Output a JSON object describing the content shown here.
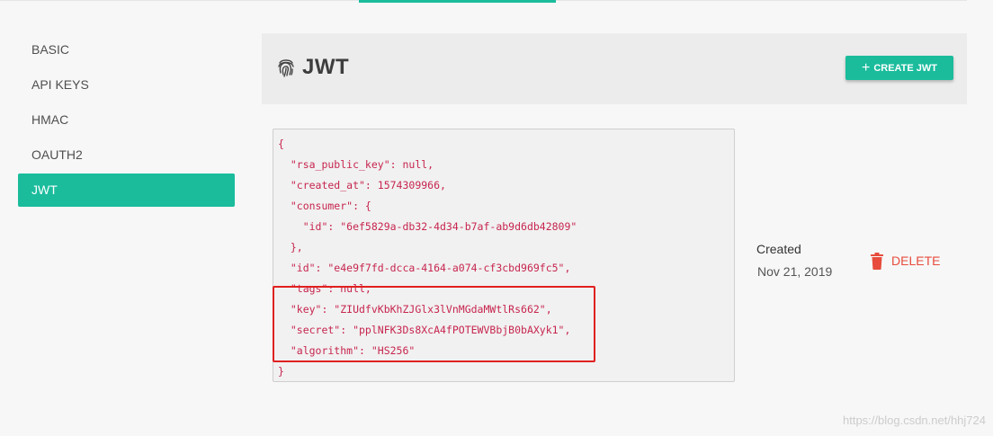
{
  "sidebar": {
    "items": [
      {
        "label": "BASIC",
        "active": false
      },
      {
        "label": "API KEYS",
        "active": false
      },
      {
        "label": "HMAC",
        "active": false
      },
      {
        "label": "OAUTH2",
        "active": false
      },
      {
        "label": "JWT",
        "active": true
      }
    ]
  },
  "header": {
    "icon": "fingerprint-icon",
    "title": "JWT",
    "create_button_label": "CREATE JWT"
  },
  "credential": {
    "json_lines": [
      "{",
      "  \"rsa_public_key\": null,",
      "  \"created_at\": 1574309966,",
      "  \"consumer\": {",
      "    \"id\": \"6ef5829a-db32-4d34-b7af-ab9d6db42809\"",
      "  },",
      "  \"id\": \"e4e9f7fd-dcca-4164-a074-cf3cbd969fc5\",",
      "  \"tags\": null,",
      "  \"key\": \"ZIUdfvKbKhZJGlx3lVnMGdaMWtlRs662\",",
      "  \"secret\": \"pplNFK3Ds8XcA4fPOTEWVBbjB0bAXyk1\",",
      "  \"algorithm\": \"HS256\"",
      "}"
    ],
    "created_label": "Created",
    "created_date": "Nov 21, 2019",
    "delete_label": "DELETE"
  },
  "watermark": "https://blog.csdn.net/hhj724",
  "colors": {
    "accent": "#1abc9c",
    "danger": "#e74c3c",
    "code": "#c7254e",
    "highlight_box": "#e02020"
  }
}
